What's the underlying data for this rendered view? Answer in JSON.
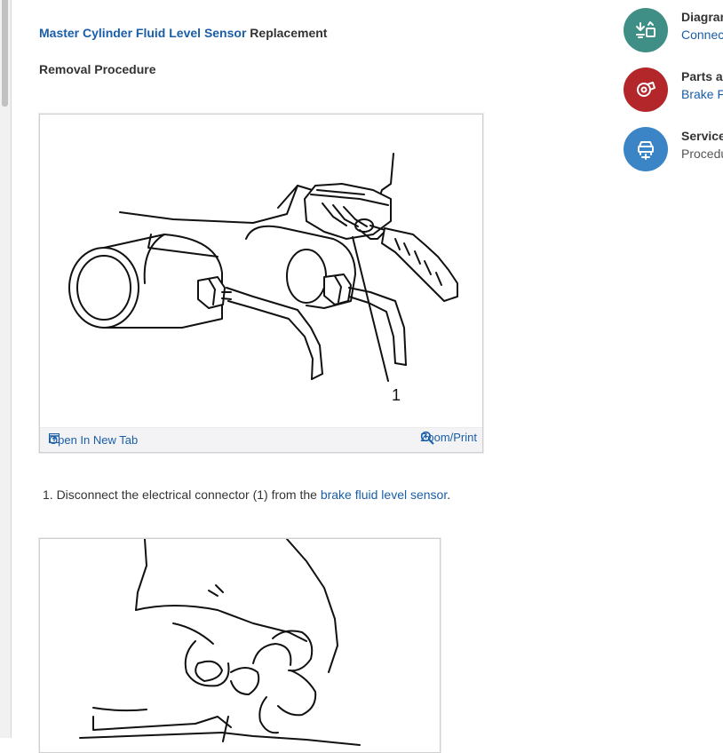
{
  "article": {
    "title_link": "Master Cylinder Fluid Level Sensor",
    "title_rest": " Replacement",
    "subtitle": "Removal Procedure"
  },
  "figure1": {
    "callout_label": "1",
    "open_tab_label": "Open In New Tab",
    "zoom_label": "Zoom/Print"
  },
  "step1": {
    "text_before": "1. Disconnect the electrical connector (1) from the ",
    "link": "brake fluid level sensor",
    "text_after": "."
  },
  "sidebar": {
    "items": [
      {
        "title": "Diagram",
        "sub": "Connec",
        "color": "#3f8f86",
        "icon": "diagram-icon"
      },
      {
        "title": "Parts ar",
        "sub": "Brake F",
        "color": "#b3272a",
        "icon": "parts-icon"
      },
      {
        "title": "Service",
        "sub": "Procedu",
        "color": "#3b84c6",
        "icon": "service-icon"
      }
    ]
  },
  "colors": {
    "link": "#1a5ea8",
    "text": "#333333"
  }
}
